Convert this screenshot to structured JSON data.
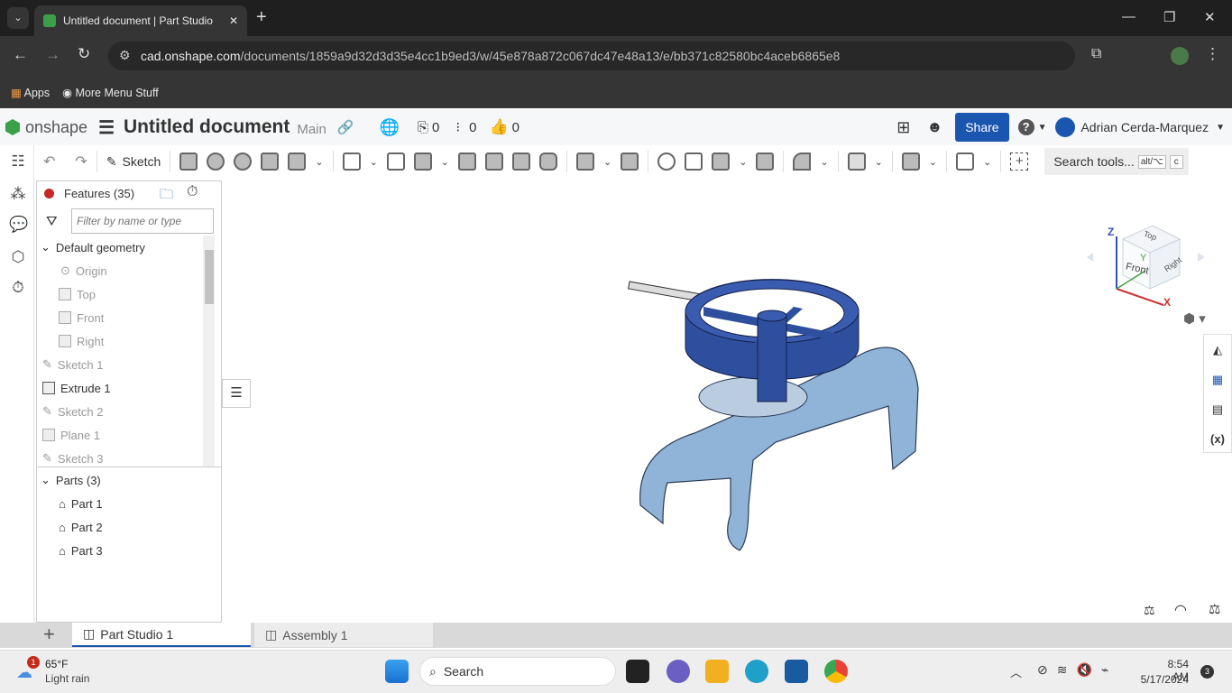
{
  "browser": {
    "tab_title": "Untitled document | Part Studio",
    "url_domain": "cad.onshape.com",
    "url_path": "/documents/1859a9d32d3d35e4cc1b9ed3/w/45e878a872c067dc47e48a13/e/bb371c82580bc4aceb6865e8",
    "bookmarks": [
      "Apps",
      "More Menu Stuff"
    ]
  },
  "header": {
    "brand": "onshape",
    "doc_title": "Untitled document",
    "branch": "Main",
    "versions_count": "0",
    "branches_count": "0",
    "likes_count": "0",
    "share_label": "Share",
    "user_name": "Adrian Cerda-Marquez"
  },
  "toolbar": {
    "sketch_label": "Sketch",
    "search_placeholder": "Search tools...",
    "shortcut1": "alt/⌥",
    "shortcut2": "c"
  },
  "features": {
    "title": "Features (35)",
    "filter_placeholder": "Filter by name or type",
    "default_geometry": "Default geometry",
    "default_items": [
      "Origin",
      "Top",
      "Front",
      "Right"
    ],
    "items": [
      {
        "label": "Sketch 1",
        "type": "sketch",
        "suppressed": true
      },
      {
        "label": "Extrude 1",
        "type": "extrude",
        "suppressed": false
      },
      {
        "label": "Sketch 2",
        "type": "sketch",
        "suppressed": true
      },
      {
        "label": "Plane 1",
        "type": "plane",
        "suppressed": true
      },
      {
        "label": "Sketch 3",
        "type": "sketch",
        "suppressed": true
      }
    ],
    "parts_title": "Parts (3)",
    "parts": [
      "Part 1",
      "Part 2",
      "Part 3"
    ]
  },
  "viewcube": {
    "top": "Top",
    "front": "Front",
    "right": "Right",
    "axis_z": "Z",
    "axis_y": "Y",
    "axis_x": "X"
  },
  "tabs": [
    {
      "label": "Part Studio 1",
      "active": true
    },
    {
      "label": "Assembly 1",
      "active": false
    }
  ],
  "taskbar": {
    "temp": "65°F",
    "weather": "Light rain",
    "weather_badge": "1",
    "search": "Search",
    "time": "8:54 AM",
    "date": "5/17/2024",
    "notif": "3"
  },
  "colors": {
    "accent": "#1a56b0",
    "part_dark": "#2a4a9a",
    "part_light": "#8fb4d8"
  }
}
